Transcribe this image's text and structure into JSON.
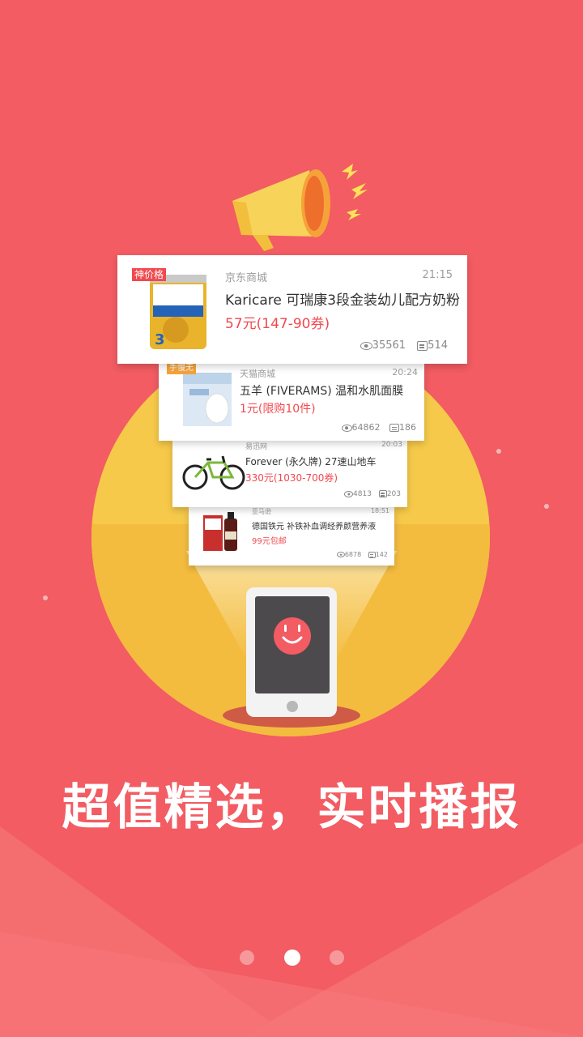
{
  "headline": "超值精选，实时播报",
  "pagination": {
    "count": 3,
    "active_index": 1
  },
  "colors": {
    "background": "#f25c62",
    "sun": "#f6c94a",
    "price": "#f0494f",
    "phone_face": "#f25c62"
  },
  "icons": {
    "megaphone": "megaphone-icon",
    "phone": "phone-icon",
    "views": "eye-icon",
    "comments": "comment-icon"
  },
  "deals": [
    {
      "tag": "神价格",
      "tag_color": "#f0494f",
      "shop": "京东商城",
      "time": "21:15",
      "title": "Karicare 可瑞康3段金装幼儿配方奶粉",
      "price": "57元(147-90券)",
      "views": "35561",
      "comments": "514",
      "image": "milk-powder-can"
    },
    {
      "tag": "手慢无",
      "tag_color": "#f6a23a",
      "shop": "天猫商城",
      "time": "20:24",
      "title": "五羊 (FIVERAMS) 温和水肌面膜",
      "price": "1元(限购10件)",
      "views": "64862",
      "comments": "186",
      "image": "face-mask"
    },
    {
      "tag": "",
      "tag_color": "",
      "shop": "易迅网",
      "time": "20:03",
      "title": "Forever (永久牌) 27速山地车",
      "price": "330元(1030-700券)",
      "views": "4813",
      "comments": "203",
      "image": "mountain-bike"
    },
    {
      "tag": "",
      "tag_color": "",
      "shop": "亚马逊",
      "time": "18:51",
      "title": "德国铁元 补铁补血调经养颜营养液",
      "price": "99元包邮",
      "views": "6878",
      "comments": "142",
      "image": "iron-tonic"
    }
  ]
}
